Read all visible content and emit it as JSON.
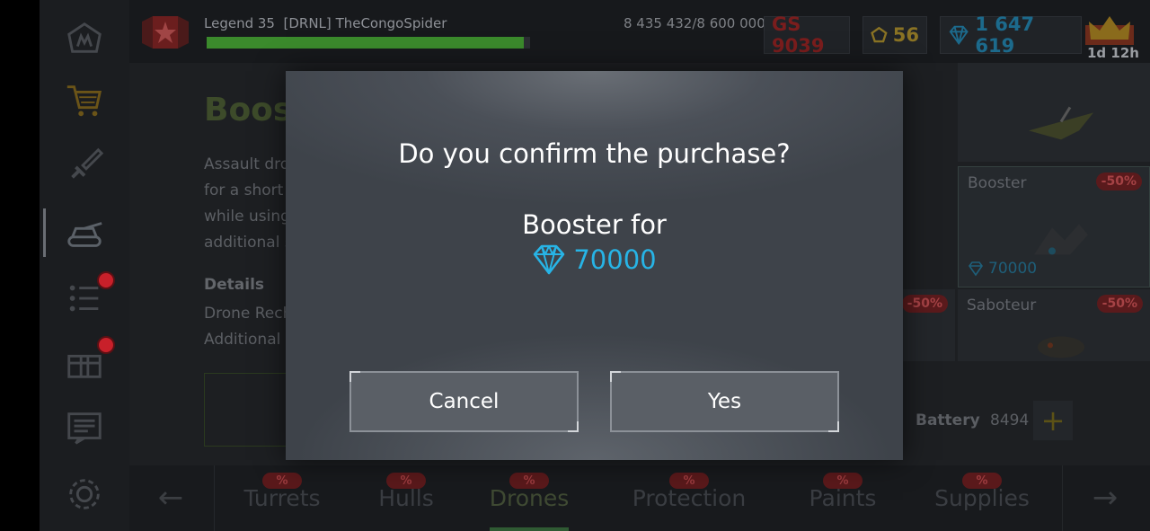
{
  "player": {
    "rank_label": "Legend 35",
    "clan_tag": "[DRNL]",
    "name": "TheCongoSpider",
    "xp_text": "8 435 432/8 600 000",
    "xp_fraction": 0.9809
  },
  "resources": {
    "gearscore": "GS 9039",
    "gold": "56",
    "crystals": "1 647 619",
    "premium_timer": "1d 12h"
  },
  "sidebar": {
    "items": [
      {
        "icon": "garage-home-icon",
        "badge": false
      },
      {
        "icon": "shop-cart-icon",
        "badge": false
      },
      {
        "icon": "sword-icon",
        "badge": false
      },
      {
        "icon": "tank-icon",
        "badge": false,
        "active": true
      },
      {
        "icon": "missions-list-icon",
        "badge": true
      },
      {
        "icon": "containers-icon",
        "badge": true
      },
      {
        "icon": "chat-icon",
        "badge": false
      },
      {
        "icon": "settings-gear-icon",
        "badge": false
      }
    ]
  },
  "item_panel": {
    "title": "Boost",
    "description_lines": [
      "Assault dro",
      "for a short",
      "while using",
      "additional s"
    ],
    "details_title": "Details",
    "details_lines": [
      "Drone Rech",
      "Additional s"
    ]
  },
  "cards": [
    {
      "name": "",
      "discount": "",
      "price": ""
    },
    {
      "name": "Booster",
      "discount": "-50%",
      "price": "70000"
    },
    {
      "name": "",
      "discount": "-50%",
      "price": ""
    },
    {
      "name": "Saboteur",
      "discount": "-50%",
      "price": ""
    }
  ],
  "battery": {
    "label": "Battery",
    "value": "8494",
    "plus": "+"
  },
  "tabs": [
    {
      "label": "Turrets",
      "badge": "%"
    },
    {
      "label": "Hulls",
      "badge": "%"
    },
    {
      "label": "Drones",
      "badge": "%",
      "active": true
    },
    {
      "label": "Protection",
      "badge": "%"
    },
    {
      "label": "Paints",
      "badge": "%"
    },
    {
      "label": "Supplies",
      "badge": "%"
    }
  ],
  "nav": {
    "prev": "←",
    "next": "→"
  },
  "dialog": {
    "question": "Do you confirm the purchase?",
    "item_line": "Booster for",
    "price": "70000",
    "cancel_label": "Cancel",
    "yes_label": "Yes"
  },
  "colors": {
    "crystal_accent": "#27b4e6",
    "gold_accent": "#e2b93a",
    "danger": "#c8202a",
    "xp_green": "#3b8a2c"
  }
}
